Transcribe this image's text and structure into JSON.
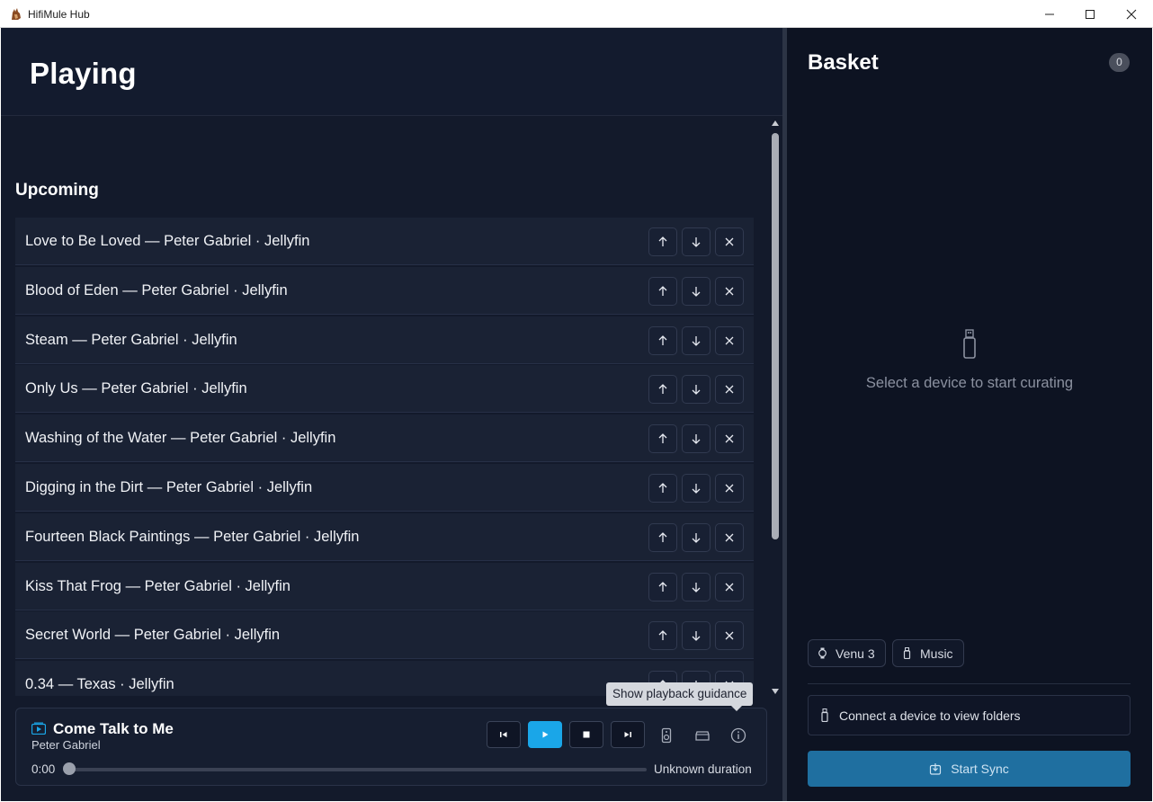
{
  "window": {
    "title": "HifiMule Hub",
    "controls": [
      "minimize-icon",
      "maximize-icon",
      "close-icon"
    ]
  },
  "playing": {
    "title": "Playing",
    "upcoming_heading": "Upcoming",
    "queue": [
      "Love to Be Loved — Peter Gabriel · Jellyfin",
      "Blood of Eden — Peter Gabriel · Jellyfin",
      "Steam — Peter Gabriel · Jellyfin",
      "Only Us — Peter Gabriel · Jellyfin",
      "Washing of the Water — Peter Gabriel · Jellyfin",
      "Digging in the Dirt — Peter Gabriel · Jellyfin",
      "Fourteen Black Paintings — Peter Gabriel · Jellyfin",
      "Kiss That Frog — Peter Gabriel · Jellyfin",
      "Secret World — Peter Gabriel · Jellyfin",
      "0.34 — Texas · Jellyfin"
    ],
    "row_actions": [
      "arrow-up-icon",
      "arrow-down-icon",
      "close-icon"
    ]
  },
  "tooltip": {
    "text": "Show playback guidance"
  },
  "player": {
    "track_title": "Come Talk to Me",
    "artist": "Peter Gabriel",
    "elapsed": "0:00",
    "duration": "Unknown duration",
    "progress": 0,
    "controls": [
      "skip-back-icon",
      "play-icon",
      "stop-icon",
      "skip-forward-icon",
      "speaker-icon",
      "device-icon",
      "info-icon"
    ],
    "accent_color": "#1aa6e8"
  },
  "basket": {
    "title": "Basket",
    "count": "0",
    "empty_message": "Select a device to start curating",
    "devices": [
      {
        "label": "Venu 3",
        "icon": "watch-icon"
      },
      {
        "label": "Music",
        "icon": "usb-drive-icon"
      }
    ],
    "folders_message": "Connect a device to view folders",
    "sync_label": "Start Sync",
    "sync_color": "#1f6fa0"
  }
}
